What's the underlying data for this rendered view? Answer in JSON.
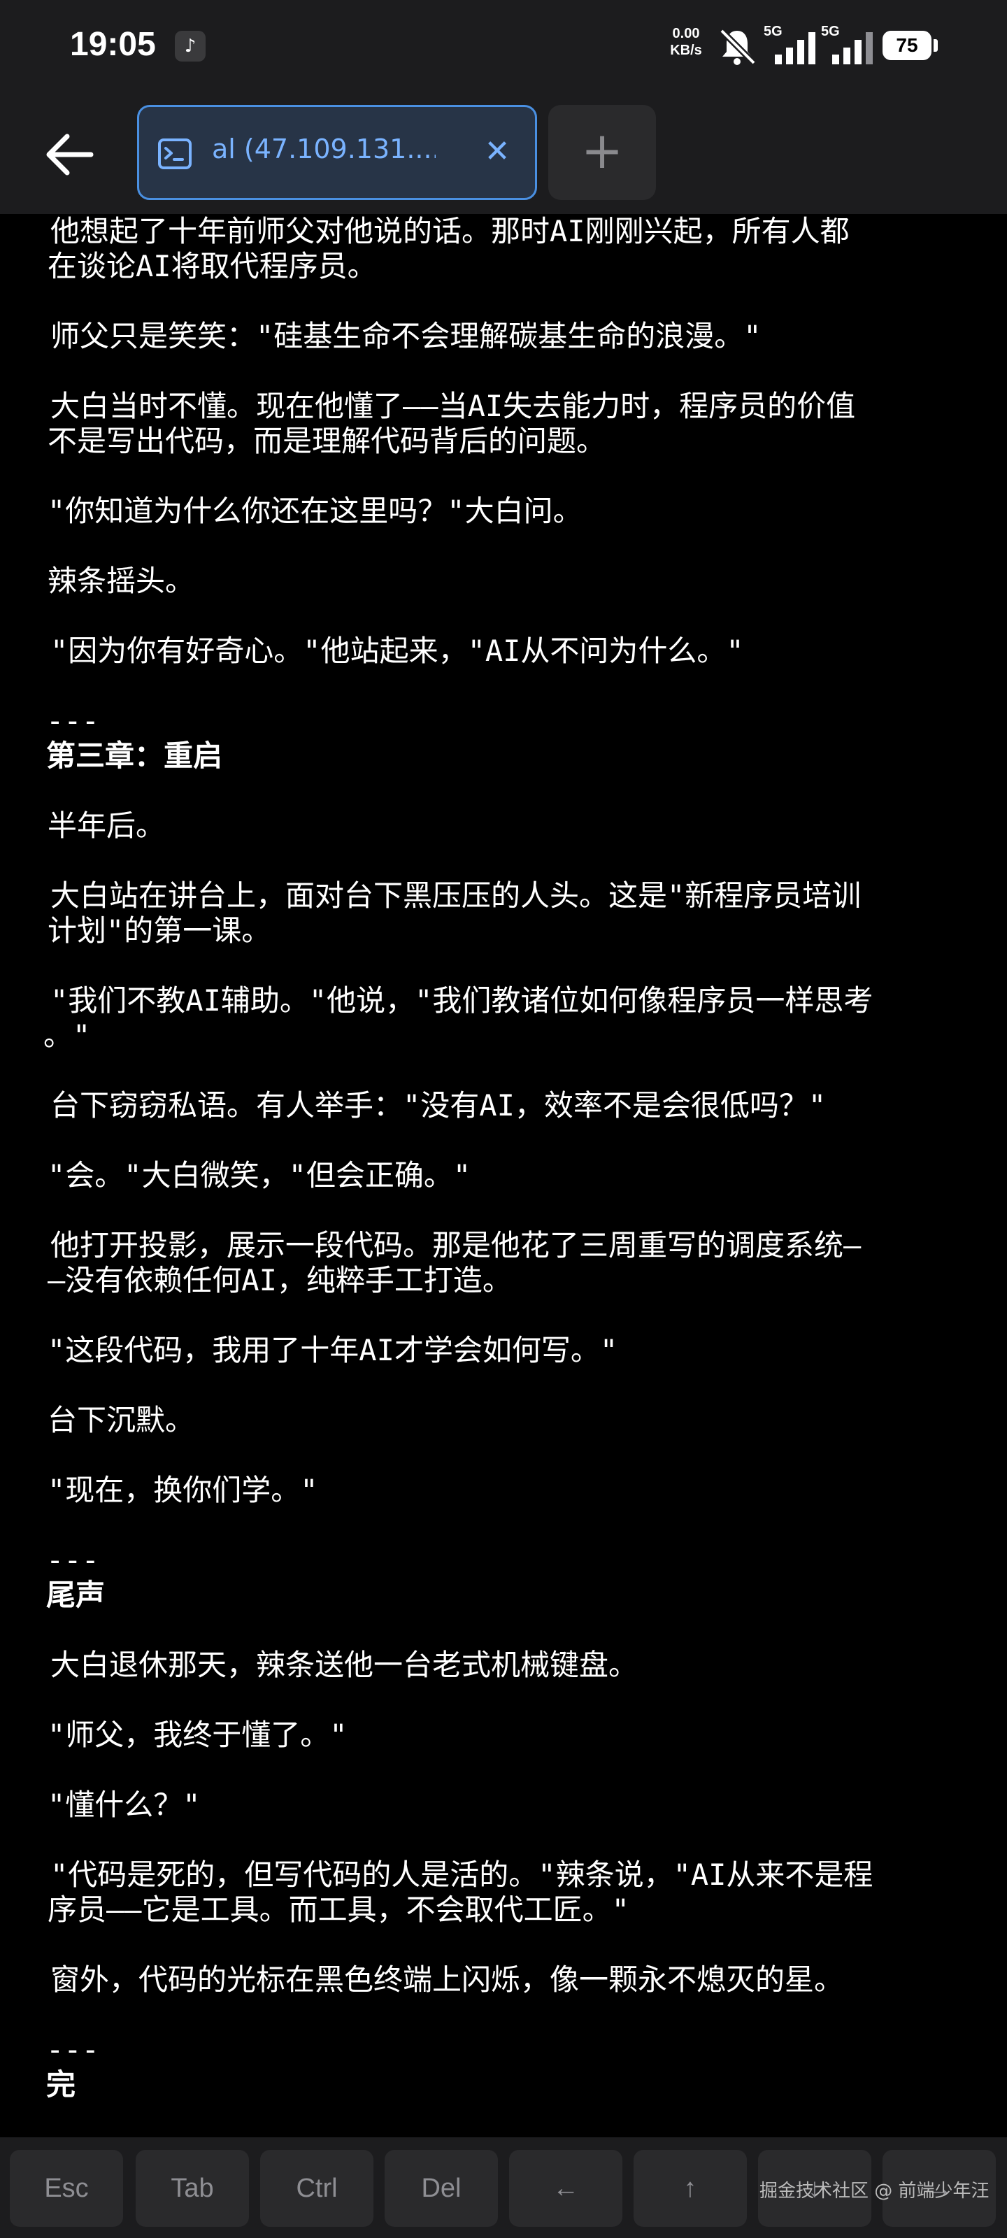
{
  "status_bar": {
    "time": "19:05",
    "net_speed_value": "0.00",
    "net_speed_unit": "KB/s",
    "signal_1_label": "5G",
    "signal_2_label": "5G",
    "battery": "75",
    "icons": [
      "tiktok-icon",
      "mute-icon",
      "signal-icon",
      "battery-icon"
    ]
  },
  "tabs": {
    "active_label": "al (47.109.131....",
    "close_symbol": "✕",
    "new_tab_symbol": "+"
  },
  "terminal_lines": [
    {
      "text": "他想起了十年前师父对他说的话。那时AI刚刚兴起，所有人都",
      "heading": false
    },
    {
      "text": "在谈论AI将取代程序员。",
      "heading": false
    },
    {
      "text": "师父只是笑笑：\"硅基生命不会理解碳基生命的浪漫。\"",
      "heading": false
    },
    {
      "text": "大白当时不懂。现在他懂了——当AI失去能力时，程序员的价值",
      "heading": false
    },
    {
      "text": "不是写出代码，而是理解代码背后的问题。",
      "heading": false
    },
    {
      "text": "\"你知道为什么你还在这里吗？\"大白问。",
      "heading": false
    },
    {
      "text": "辣条摇头。",
      "heading": false
    },
    {
      "text": "\"因为你有好奇心。\"他站起来，\"AI从不问为什么。\"",
      "heading": false
    },
    {
      "text": "---",
      "heading": false
    },
    {
      "text": "第三章：重启",
      "heading": true
    },
    {
      "text": "半年后。",
      "heading": false
    },
    {
      "text": "大白站在讲台上，面对台下黑压压的人头。这是\"新程序员培训",
      "heading": false
    },
    {
      "text": "计划\"的第一课。",
      "heading": false
    },
    {
      "text": "\"我们不教AI辅助。\"他说，\"我们教诸位如何像程序员一样思考",
      "heading": false
    },
    {
      "text": "。\"",
      "heading": false
    },
    {
      "text": "台下窃窃私语。有人举手：\"没有AI，效率不是会很低吗？\"",
      "heading": false
    },
    {
      "text": "\"会。\"大白微笑，\"但会正确。\"",
      "heading": false
    },
    {
      "text": "他打开投影，展示一段代码。那是他花了三周重写的调度系统—",
      "heading": false
    },
    {
      "text": "—没有依赖任何AI，纯粹手工打造。",
      "heading": false
    },
    {
      "text": "\"这段代码，我用了十年AI才学会如何写。\"",
      "heading": false
    },
    {
      "text": "台下沉默。",
      "heading": false
    },
    {
      "text": "\"现在，换你们学。\"",
      "heading": false
    },
    {
      "text": "---",
      "heading": false
    },
    {
      "text": "尾声",
      "heading": true
    },
    {
      "text": "大白退休那天，辣条送他一台老式机械键盘。",
      "heading": false
    },
    {
      "text": "\"师父，我终于懂了。\"",
      "heading": false
    },
    {
      "text": "\"懂什么？\"",
      "heading": false
    },
    {
      "text": "\"代码是死的，但写代码的人是活的。\"辣条说，\"AI从来不是程",
      "heading": false
    },
    {
      "text": "序员——它是工具。而工具，不会取代工匠。\"",
      "heading": false
    },
    {
      "text": "窗外，代码的光标在黑色终端上闪烁，像一颗永不熄灭的星。",
      "heading": false
    },
    {
      "text": "---",
      "heading": false
    },
    {
      "text": "完",
      "heading": true
    }
  ],
  "keys": [
    "Esc",
    "Tab",
    "Ctrl",
    "Del",
    "←",
    "↑",
    "↓",
    "→"
  ],
  "watermark": "掘金技术社区 @ 前端少年汪"
}
